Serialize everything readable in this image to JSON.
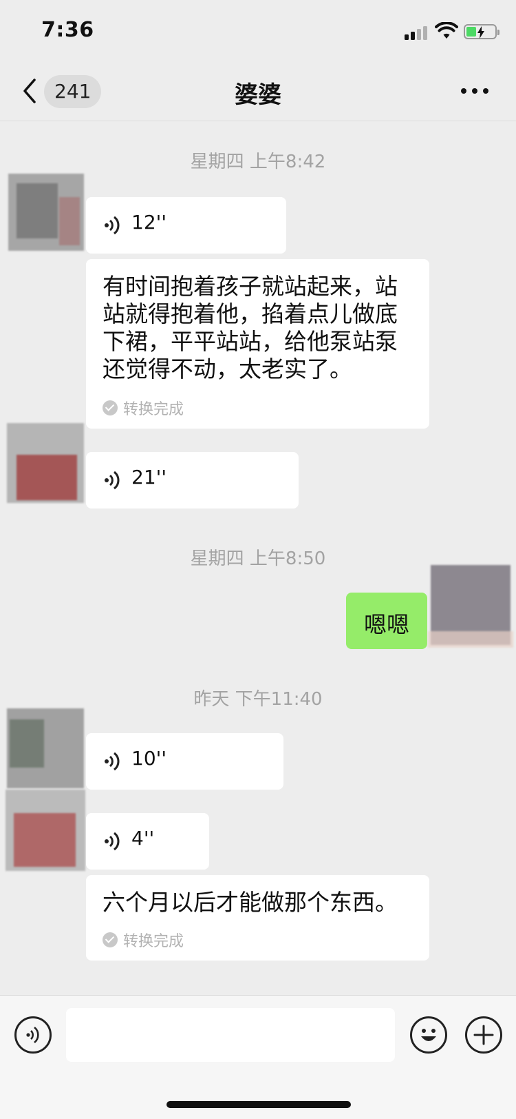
{
  "status_bar": {
    "time": "7:36",
    "icons": [
      "cellular-signal-icon",
      "wifi-icon",
      "battery-charging-icon"
    ]
  },
  "nav": {
    "back_icon": "chevron-left-icon",
    "unread_count": "241",
    "title": "婆婆",
    "more_icon": "ellipsis-icon"
  },
  "messages": {
    "ts1": "星期四 上午8:42",
    "voice1": {
      "duration": "12''",
      "icon": "voice-wave-icon"
    },
    "transcript1": {
      "line1": "有时间抱着孩子就站起来，站",
      "line2": "站就得抱着他，掐着点儿做底",
      "line3": "下裙，平平站站，给他泵站泵",
      "line4": "还觉得不动，太老实了。",
      "status": "转换完成"
    },
    "voice2": {
      "duration": "21''"
    },
    "ts2": "星期四 上午8:50",
    "sent1": "嗯嗯",
    "ts3": "昨天 下午11:40",
    "voice3": {
      "duration": "10''"
    },
    "voice4": {
      "duration": "4''"
    },
    "transcript2": {
      "text": "六个月以后才能做那个东西。",
      "status": "转换完成"
    }
  },
  "input_bar": {
    "voice_icon": "voice-input-icon",
    "placeholder": "",
    "emoji_icon": "emoji-icon",
    "plus_icon": "plus-icon"
  },
  "colors": {
    "background": "#ededed",
    "bubble_received": "#ffffff",
    "bubble_sent": "#95ec69",
    "timestamp": "#a3a3a3"
  }
}
